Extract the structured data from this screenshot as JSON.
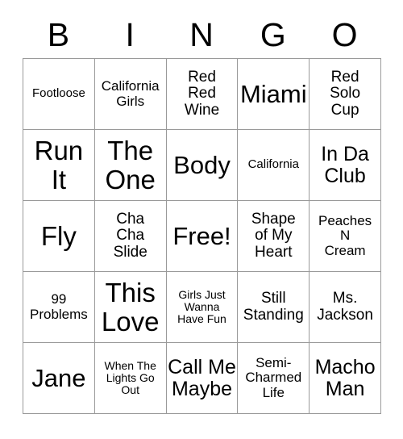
{
  "card": {
    "header": {
      "letters": [
        "B",
        "I",
        "N",
        "G",
        "O"
      ]
    },
    "rows": [
      [
        {
          "text": "Footloose",
          "size": "s-sm"
        },
        {
          "text": "California\nGirls",
          "size": "s-md"
        },
        {
          "text": "Red\nRed\nWine",
          "size": "s-lg"
        },
        {
          "text": "Miami",
          "size": "s-xxl"
        },
        {
          "text": "Red\nSolo\nCup",
          "size": "s-lg"
        }
      ],
      [
        {
          "text": "Run\nIt",
          "size": "s-hero"
        },
        {
          "text": "The\nOne",
          "size": "s-hero"
        },
        {
          "text": "Body",
          "size": "s-xxl"
        },
        {
          "text": "California",
          "size": "s-sm"
        },
        {
          "text": "In Da\nClub",
          "size": "s-xl"
        }
      ],
      [
        {
          "text": "Fly",
          "size": "s-hero"
        },
        {
          "text": "Cha\nCha\nSlide",
          "size": "s-lg"
        },
        {
          "text": "Free!",
          "size": "s-xxl"
        },
        {
          "text": "Shape\nof My\nHeart",
          "size": "s-lg"
        },
        {
          "text": "Peaches\nN\nCream",
          "size": "s-md"
        }
      ],
      [
        {
          "text": "99\nProblems",
          "size": "s-md"
        },
        {
          "text": "This\nLove",
          "size": "s-hero"
        },
        {
          "text": "Girls Just\nWanna\nHave Fun",
          "size": "s-xs"
        },
        {
          "text": "Still\nStanding",
          "size": "s-lg"
        },
        {
          "text": "Ms.\nJackson",
          "size": "s-lg"
        }
      ],
      [
        {
          "text": "Jane",
          "size": "s-xxl"
        },
        {
          "text": "When The\nLights Go\nOut",
          "size": "s-xs"
        },
        {
          "text": "Call Me\nMaybe",
          "size": "s-xl"
        },
        {
          "text": "Semi-\nCharmed\nLife",
          "size": "s-md"
        },
        {
          "text": "Macho\nMan",
          "size": "s-xl"
        }
      ]
    ]
  }
}
